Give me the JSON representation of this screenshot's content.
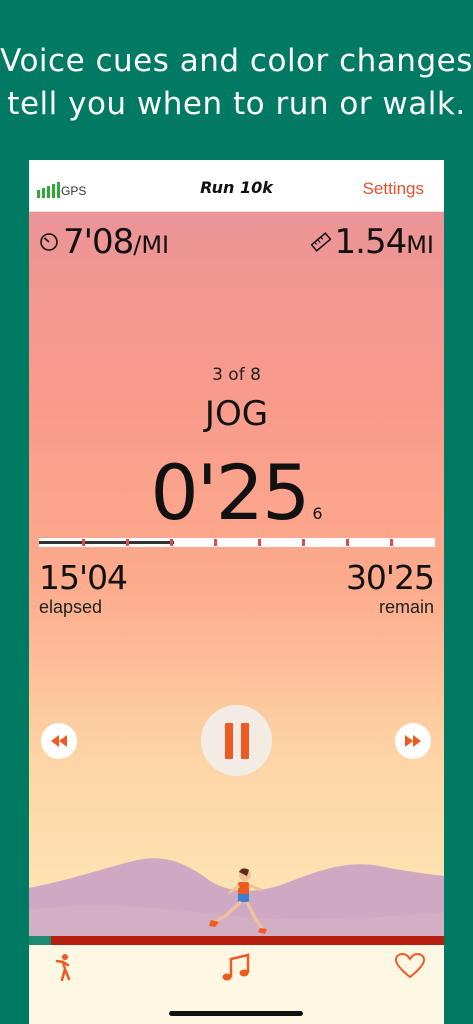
{
  "headline": {
    "line1": "Voice cues and color changes",
    "line2": "tell you when to run or walk."
  },
  "navbar": {
    "gps_label": "GPS",
    "title": "Run 10k",
    "settings_label": "Settings"
  },
  "stats": {
    "pace_value": "7'08",
    "pace_unit": "/MI",
    "distance_value": "1.54",
    "distance_unit": "MI"
  },
  "interval": {
    "count": "3 of 8",
    "name": "JOG",
    "countdown": "0'25",
    "tenths": "6"
  },
  "progress": {
    "completed_fraction": 0.34,
    "segment_count": 9
  },
  "times": {
    "elapsed_value": "15'04",
    "elapsed_label": "elapsed",
    "remain_value": "30'25",
    "remain_label": "remain"
  },
  "controls": {
    "back_icon": "skip-back-icon",
    "pause_icon": "pause-icon",
    "forward_icon": "skip-forward-icon"
  },
  "tabbar": {
    "tabs": [
      "stretch-icon",
      "music-icon",
      "heart-icon"
    ]
  },
  "colors": {
    "accent": "#e4502b",
    "pause": "#ef5a23",
    "gps_signal": "#2ea836",
    "background": "#007a63"
  }
}
